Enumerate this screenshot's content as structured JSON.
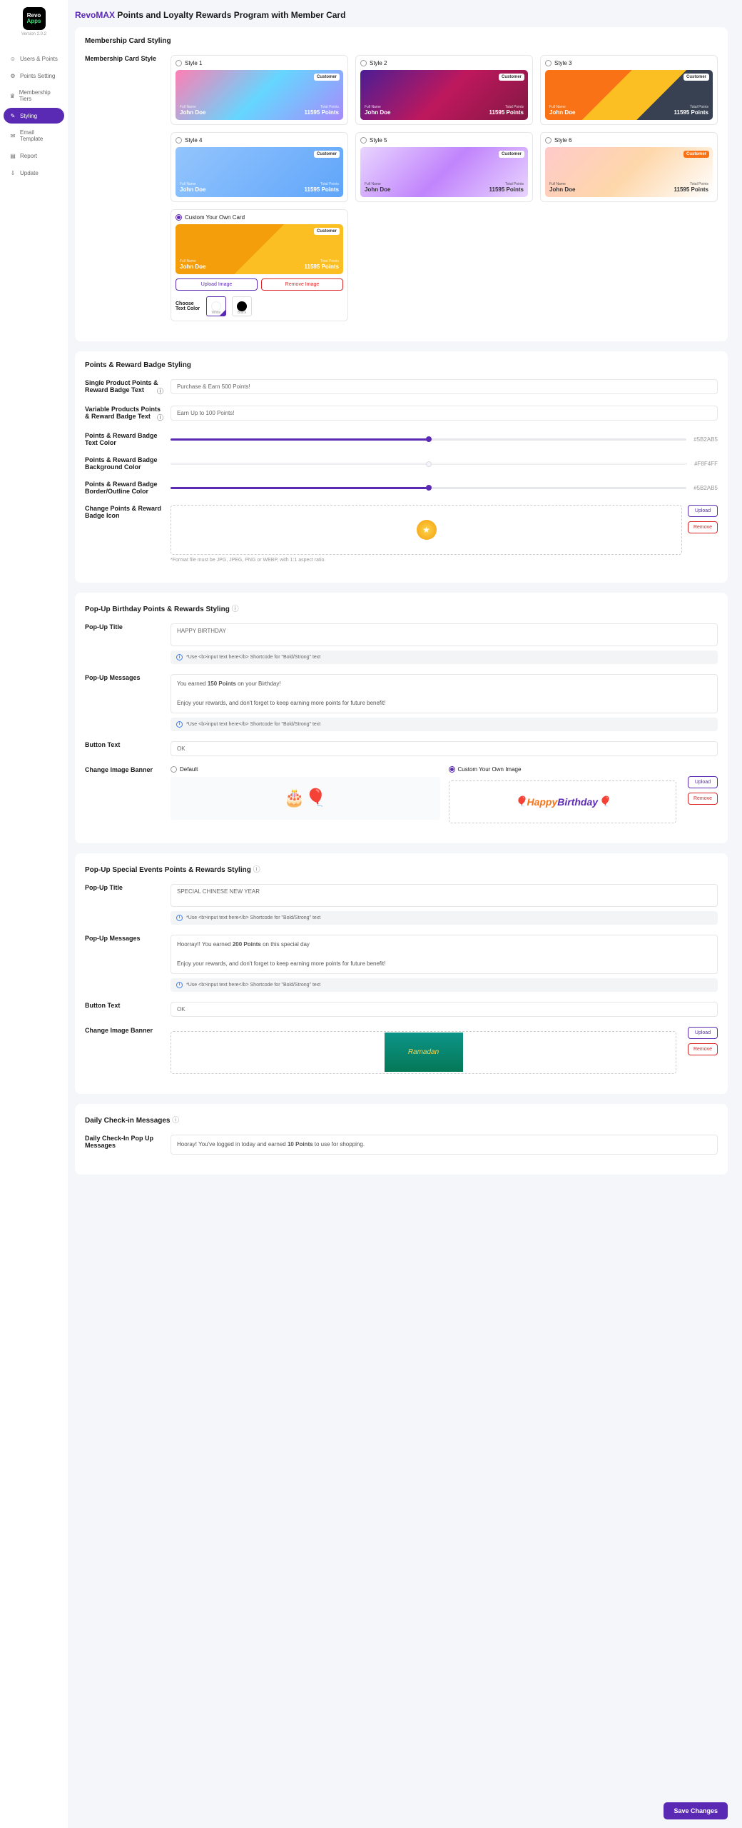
{
  "app": {
    "logo1": "Revo",
    "logo2": "Apps",
    "version": "Version 2.0.2"
  },
  "nav": {
    "items": [
      {
        "label": "Users & Points"
      },
      {
        "label": "Points Setting"
      },
      {
        "label": "Membership Tiers"
      },
      {
        "label": "Styling"
      },
      {
        "label": "Email Template"
      },
      {
        "label": "Report"
      },
      {
        "label": "Update"
      }
    ]
  },
  "title": {
    "brand": "RevoMAX",
    "rest": " Points and Loyalty Rewards Program with Member Card"
  },
  "section1": {
    "heading": "Membership Card Styling",
    "label": "Membership Card Style",
    "styles": [
      {
        "name": "Style 1"
      },
      {
        "name": "Style 2"
      },
      {
        "name": "Style 3"
      },
      {
        "name": "Style 4"
      },
      {
        "name": "Style 5"
      },
      {
        "name": "Style 6"
      }
    ],
    "custom": "Custom Your Own Card",
    "badge": "Customer",
    "fn_lbl": "Full Name",
    "fn_val": "John Doe",
    "tp_lbl": "Total Points",
    "tp_val": "11595 Points",
    "upload": "Upload Image",
    "remove": "Remove Image",
    "choose": "Choose Text Color",
    "white": "White",
    "black": "Black"
  },
  "section2": {
    "heading": "Points & Reward Badge Styling",
    "f1": {
      "label": "Single Product Points & Reward Badge Text",
      "value": "Purchase & Earn 500 Points!"
    },
    "f2": {
      "label": "Variable Products Points & Reward Badge Text",
      "value": "Earn Up to 100 Points!"
    },
    "f3": {
      "label": "Points & Reward Badge Text Color",
      "hex": "#5B2AB5"
    },
    "f4": {
      "label": "Points & Reward Badge Background Color",
      "hex": "#F8F4FF"
    },
    "f5": {
      "label": "Points & Reward Badge Border/Outline Color",
      "hex": "#5B2AB5"
    },
    "f6": {
      "label": "Change Points & Reward Badge Icon",
      "upload": "Upload",
      "remove": "Remove",
      "hint": "*Format file must be JPG, JPEG, PNG or WEBP, with 1:1 aspect ratio."
    }
  },
  "section3": {
    "heading": "Pop-Up Birthday Points & Rewards Styling",
    "f1": {
      "label": "Pop-Up Title",
      "value": "HAPPY BIRTHDAY"
    },
    "f2": {
      "label": "Pop-Up Messages",
      "line1a": "You earned ",
      "line1b": "150 Points",
      "line1c": " on your Birthday!",
      "line2": "Enjoy your rewards, and don't forget to keep earning more points for future benefit!"
    },
    "f3": {
      "label": "Button Text",
      "value": "OK"
    },
    "f4": {
      "label": "Change Image Banner",
      "default": "Default",
      "custom": "Custom Your Own Image",
      "upload": "Upload",
      "remove": "Remove",
      "hb1": "Happy",
      "hb2": "Birthday"
    },
    "hint": "*Use <b>input text here</b> Shortcode for \"Bold/Strong\" text"
  },
  "section4": {
    "heading": "Pop-Up Special Events Points & Rewards Styling",
    "f1": {
      "label": "Pop-Up Title",
      "value": "SPECIAL CHINESE NEW YEAR"
    },
    "f2": {
      "label": "Pop-Up Messages",
      "line1a": "Hoorray!! You earned ",
      "line1b": "200 Points",
      "line1c": " on this special day",
      "line2": "Enjoy your rewards, and don't forget to keep earning more points for future benefit!"
    },
    "f3": {
      "label": "Button Text",
      "value": "OK"
    },
    "f4": {
      "label": "Change Image Banner",
      "upload": "Upload",
      "remove": "Remove",
      "ramadan": "Ramadan"
    },
    "hint": "*Use <b>input text here</b> Shortcode for \"Bold/Strong\" text"
  },
  "section5": {
    "heading": "Daily Check-in Messages",
    "f1": {
      "label": "Daily Check-In Pop Up Messages",
      "a": "Hooray! You've logged in today and earned ",
      "b": "10 Points",
      "c": " to use for shopping."
    }
  },
  "save": "Save Changes"
}
